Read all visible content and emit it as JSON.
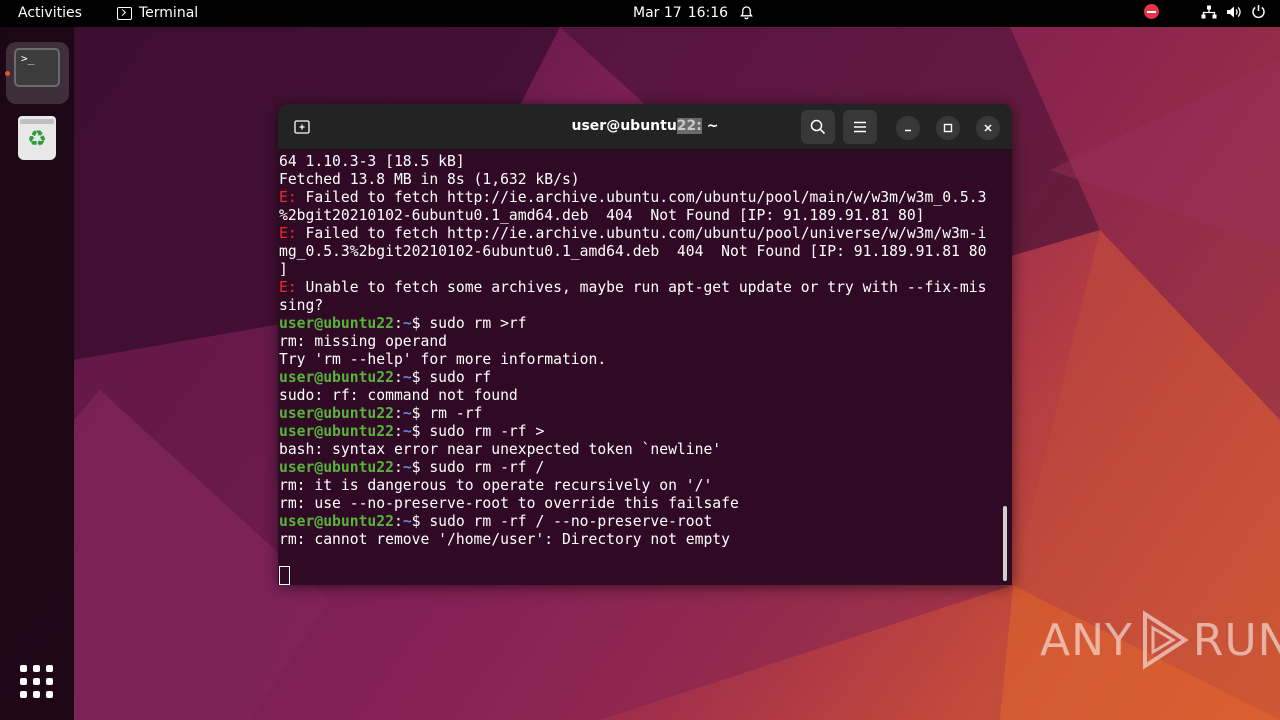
{
  "topbar": {
    "activities": "Activities",
    "app_name": "Terminal",
    "date": "Mar 17",
    "time": "16:16"
  },
  "dock": {
    "terminal_icon_text": ">_",
    "trash_symbol": "♻"
  },
  "terminal": {
    "title_prefix": "user@ubuntu",
    "title_highlight": "22:",
    "title_suffix": " ~",
    "lines": [
      {
        "type": "plain",
        "text": "64 1.10.3-3 [18.5 kB]"
      },
      {
        "type": "plain",
        "text": "Fetched 13.8 MB in 8s (1,632 kB/s)"
      },
      {
        "type": "error",
        "tag": "E:",
        "text": " Failed to fetch http://ie.archive.ubuntu.com/ubuntu/pool/main/w/w3m/w3m_0.5.3"
      },
      {
        "type": "plain",
        "text": "%2bgit20210102-6ubuntu0.1_amd64.deb  404  Not Found [IP: 91.189.91.81 80]"
      },
      {
        "type": "error",
        "tag": "E:",
        "text": " Failed to fetch http://ie.archive.ubuntu.com/ubuntu/pool/universe/w/w3m/w3m-i"
      },
      {
        "type": "plain",
        "text": "mg_0.5.3%2bgit20210102-6ubuntu0.1_amd64.deb  404  Not Found [IP: 91.189.91.81 80"
      },
      {
        "type": "plain",
        "text": "]"
      },
      {
        "type": "error",
        "tag": "E:",
        "text": " Unable to fetch some archives, maybe run apt-get update or try with --fix-mis"
      },
      {
        "type": "plain",
        "text": "sing?"
      },
      {
        "type": "prompt",
        "user": "user@ubuntu22",
        "sep": ":",
        "path": "~",
        "cmd": "$ sudo rm >rf"
      },
      {
        "type": "plain",
        "text": "rm: missing operand"
      },
      {
        "type": "plain",
        "text": "Try 'rm --help' for more information."
      },
      {
        "type": "prompt",
        "user": "user@ubuntu22",
        "sep": ":",
        "path": "~",
        "cmd": "$ sudo rf"
      },
      {
        "type": "plain",
        "text": "sudo: rf: command not found"
      },
      {
        "type": "prompt",
        "user": "user@ubuntu22",
        "sep": ":",
        "path": "~",
        "cmd": "$ rm -rf"
      },
      {
        "type": "prompt",
        "user": "user@ubuntu22",
        "sep": ":",
        "path": "~",
        "cmd": "$ sudo rm -rf >"
      },
      {
        "type": "plain",
        "text": "bash: syntax error near unexpected token `newline'"
      },
      {
        "type": "prompt",
        "user": "user@ubuntu22",
        "sep": ":",
        "path": "~",
        "cmd": "$ sudo rm -rf /"
      },
      {
        "type": "plain",
        "text": "rm: it is dangerous to operate recursively on '/'"
      },
      {
        "type": "plain",
        "text": "rm: use --no-preserve-root to override this failsafe"
      },
      {
        "type": "prompt",
        "user": "user@ubuntu22",
        "sep": ":",
        "path": "~",
        "cmd": "$ sudo rm -rf / --no-preserve-root"
      },
      {
        "type": "plain",
        "text": "rm: cannot remove '/home/user': Directory not empty"
      }
    ]
  },
  "watermark": {
    "left": "ANY",
    "right": "RUN"
  }
}
